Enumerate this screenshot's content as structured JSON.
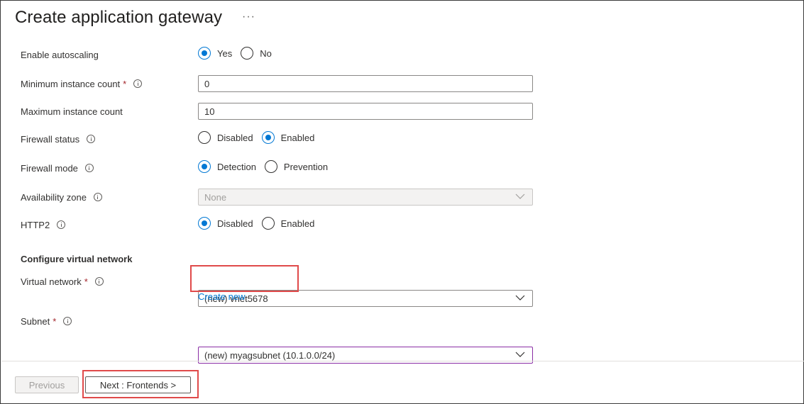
{
  "header": {
    "title": "Create application gateway",
    "more_label": "···"
  },
  "form": {
    "autoscaling": {
      "label": "Enable autoscaling",
      "options": [
        "Yes",
        "No"
      ],
      "selected": "Yes"
    },
    "min_instance": {
      "label": "Minimum instance count",
      "required_mark": "*",
      "value": "0"
    },
    "max_instance": {
      "label": "Maximum instance count",
      "value": "10"
    },
    "firewall_status": {
      "label": "Firewall status",
      "options": [
        "Disabled",
        "Enabled"
      ],
      "selected": "Enabled"
    },
    "firewall_mode": {
      "label": "Firewall mode",
      "options": [
        "Detection",
        "Prevention"
      ],
      "selected": "Detection"
    },
    "availability_zone": {
      "label": "Availability zone",
      "value": "None"
    },
    "http2": {
      "label": "HTTP2",
      "options": [
        "Disabled",
        "Enabled"
      ],
      "selected": "Disabled"
    },
    "vnet_section": {
      "heading": "Configure virtual network"
    },
    "virtual_network": {
      "label": "Virtual network",
      "required_mark": "*",
      "value": "(new) vnet5678",
      "create_new_label": "Create new"
    },
    "subnet": {
      "label": "Subnet",
      "required_mark": "*",
      "value": "(new) myagsubnet (10.1.0.0/24)"
    }
  },
  "footer": {
    "previous_label": "Previous",
    "next_label": "Next : Frontends >"
  },
  "colors": {
    "accent": "#0078d4",
    "required": "#a4262c",
    "highlight": "#e04a4a",
    "subnet_border": "#8a2da5"
  }
}
